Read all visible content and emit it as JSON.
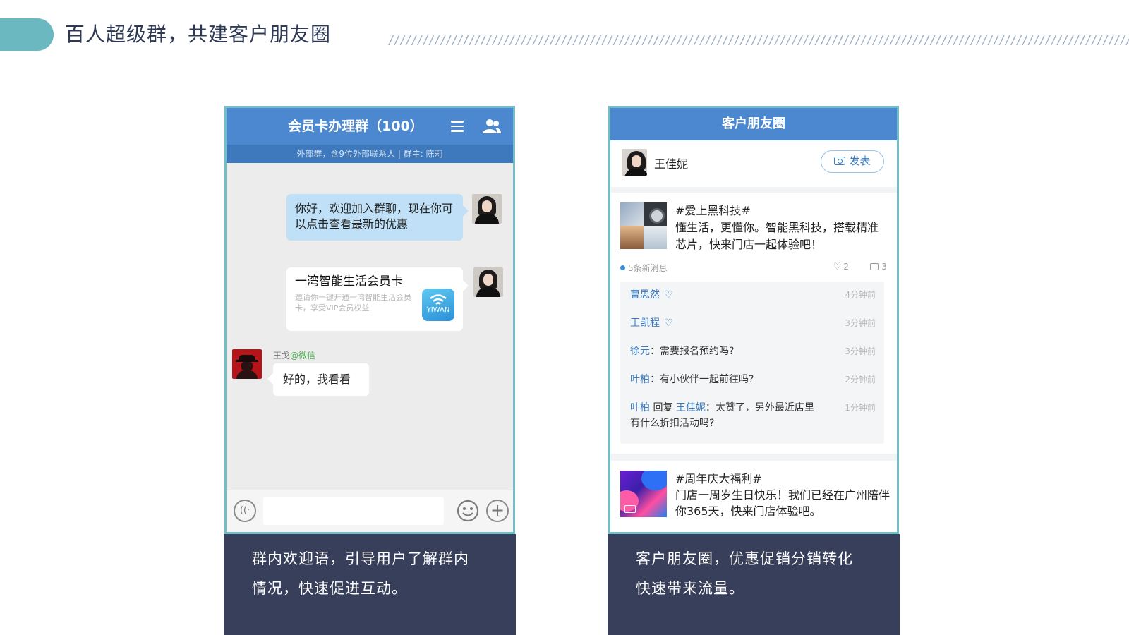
{
  "slide": {
    "title": "百人超级群，共建客户朋友圈"
  },
  "chat_phone": {
    "title": "会员卡办理群（100）",
    "subtitle": "外部群，含9位外部联系人 | 群主: 陈莉",
    "welcome_message": "你好，欢迎加入群聊，现在你可以点击查看最新的优惠",
    "card": {
      "title": "一湾智能生活会员卡",
      "desc": "邀请你一键开通一湾智能生活会员卡，享受VIP会员权益",
      "logo_text": "YIWAN"
    },
    "sender": {
      "name": "王戈",
      "source": "@微信"
    },
    "reply_message": "好的，我看看",
    "input_placeholder": ""
  },
  "moments_phone": {
    "title": "客户朋友圈",
    "user_name": "王佳妮",
    "post_button": "发表",
    "post1": {
      "tag": "#爱上黑科技#",
      "text": "懂生活，更懂你。智能黑科技，搭载精准芯片，快来门店一起体验吧！",
      "new_messages": "5条新消息",
      "likes": "2",
      "comments": "3",
      "comment_list": [
        {
          "name": "曹思然",
          "text": "",
          "like": true,
          "time": "4分钟前"
        },
        {
          "name": "王凯程",
          "text": "",
          "like": true,
          "time": "3分钟前"
        },
        {
          "name": "徐元",
          "text": "：需要报名预约吗?",
          "like": false,
          "time": "3分钟前"
        },
        {
          "name": "叶柏",
          "text": "：有小伙伴一起前往吗?",
          "like": false,
          "time": "2分钟前"
        }
      ],
      "reply": {
        "name": "叶柏",
        "reply_word": " 回复 ",
        "target": "王佳妮",
        "text_line1": "：太赞了，另外最近店里",
        "text_line2": "有什么折扣活动吗?",
        "time": "1分钟前"
      }
    },
    "post2": {
      "tag": "#周年庆大福利#",
      "text": "门店一周岁生日快乐！我们已经在广州陪伴你365天，快来门店体验吧。"
    }
  },
  "captions": {
    "left_line1": "群内欢迎语，引导用户了解群内",
    "left_line2": "情况，快速促进互动。",
    "right_line1": "客户朋友圈，优惠促销分销转化",
    "right_line2": "快速带来流量。"
  },
  "colors": {
    "accent": "#6bb8c0",
    "header_blue": "#4b88cf",
    "caption_bg": "#373f5b",
    "link_blue": "#3a7cc6"
  },
  "icons": [
    "menu-icon",
    "members-icon",
    "voice-icon",
    "emoji-icon",
    "plus-icon",
    "camera-icon",
    "heart-icon",
    "comment-icon",
    "video-icon",
    "wifi-icon"
  ]
}
